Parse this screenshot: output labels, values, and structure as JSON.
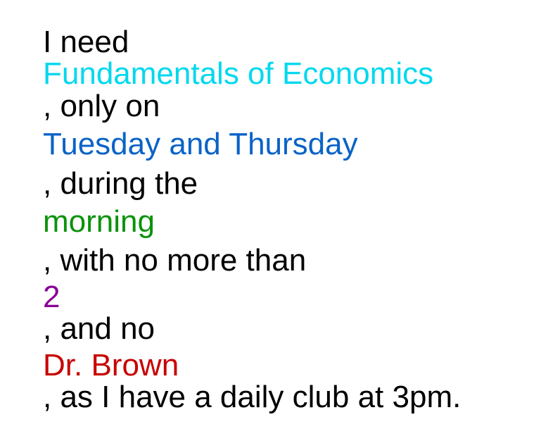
{
  "request": {
    "line1": "I need",
    "course": "Fundamentals of Economics",
    "line3": ", only on",
    "days": "Tuesday and Thursday",
    "line5": ", during the",
    "time_of_day": "morning",
    "line7": ", with no more than",
    "max_count": "2",
    "line9": ", and no",
    "professor": "Dr. Brown",
    "line11": ", as I have a daily club at 3pm."
  },
  "colors": {
    "text": "#000000",
    "course": "#00d8ee",
    "days": "#0a63c7",
    "time_of_day": "#0a930a",
    "max_count": "#8a0096",
    "professor": "#c80000"
  }
}
